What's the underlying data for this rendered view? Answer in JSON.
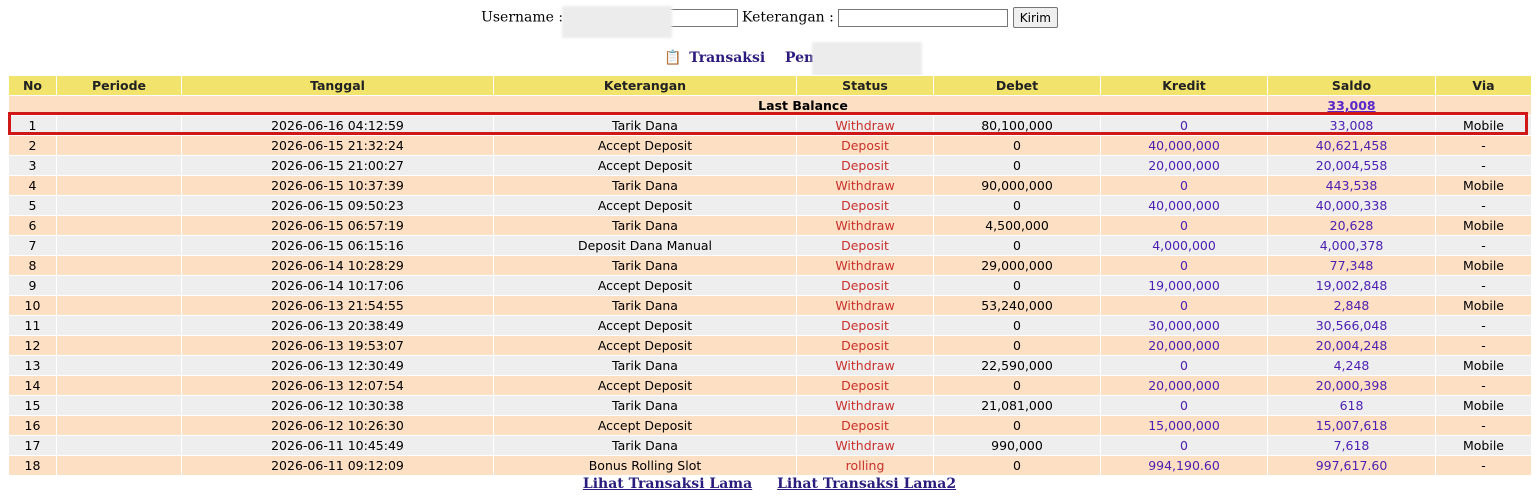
{
  "form": {
    "username_label": "Username :",
    "username_value": "",
    "keterangan_label": "Keterangan :",
    "keterangan_value": "",
    "submit_label": "Kirim"
  },
  "title": {
    "icon": "document-icon",
    "transaksi": "Transaksi",
    "pemain": "Pemain : ro"
  },
  "columns": [
    "No",
    "Periode",
    "Tanggal",
    "Keterangan",
    "Status",
    "Debet",
    "Kredit",
    "Saldo",
    "Via"
  ],
  "last_balance": {
    "label": "Last Balance",
    "value": "33,008"
  },
  "rows": [
    {
      "no": "1",
      "periode": "",
      "tanggal": "2026-06-16 04:12:59",
      "keterangan": "Tarik Dana",
      "status": "Withdraw",
      "debet": "80,100,000",
      "kredit": "0",
      "saldo": "33,008",
      "via": "Mobile"
    },
    {
      "no": "2",
      "periode": "",
      "tanggal": "2026-06-15 21:32:24",
      "keterangan": "Accept Deposit",
      "status": "Deposit",
      "debet": "0",
      "kredit": "40,000,000",
      "saldo": "40,621,458",
      "via": "-"
    },
    {
      "no": "3",
      "periode": "",
      "tanggal": "2026-06-15 21:00:27",
      "keterangan": "Accept Deposit",
      "status": "Deposit",
      "debet": "0",
      "kredit": "20,000,000",
      "saldo": "20,004,558",
      "via": "-"
    },
    {
      "no": "4",
      "periode": "",
      "tanggal": "2026-06-15 10:37:39",
      "keterangan": "Tarik Dana",
      "status": "Withdraw",
      "debet": "90,000,000",
      "kredit": "0",
      "saldo": "443,538",
      "via": "Mobile"
    },
    {
      "no": "5",
      "periode": "",
      "tanggal": "2026-06-15 09:50:23",
      "keterangan": "Accept Deposit",
      "status": "Deposit",
      "debet": "0",
      "kredit": "40,000,000",
      "saldo": "40,000,338",
      "via": "-"
    },
    {
      "no": "6",
      "periode": "",
      "tanggal": "2026-06-15 06:57:19",
      "keterangan": "Tarik Dana",
      "status": "Withdraw",
      "debet": "4,500,000",
      "kredit": "0",
      "saldo": "20,628",
      "via": "Mobile"
    },
    {
      "no": "7",
      "periode": "",
      "tanggal": "2026-06-15 06:15:16",
      "keterangan": "Deposit Dana Manual",
      "status": "Deposit",
      "debet": "0",
      "kredit": "4,000,000",
      "saldo": "4,000,378",
      "via": "-"
    },
    {
      "no": "8",
      "periode": "",
      "tanggal": "2026-06-14 10:28:29",
      "keterangan": "Tarik Dana",
      "status": "Withdraw",
      "debet": "29,000,000",
      "kredit": "0",
      "saldo": "77,348",
      "via": "Mobile"
    },
    {
      "no": "9",
      "periode": "",
      "tanggal": "2026-06-14 10:17:06",
      "keterangan": "Accept Deposit",
      "status": "Deposit",
      "debet": "0",
      "kredit": "19,000,000",
      "saldo": "19,002,848",
      "via": "-"
    },
    {
      "no": "10",
      "periode": "",
      "tanggal": "2026-06-13 21:54:55",
      "keterangan": "Tarik Dana",
      "status": "Withdraw",
      "debet": "53,240,000",
      "kredit": "0",
      "saldo": "2,848",
      "via": "Mobile"
    },
    {
      "no": "11",
      "periode": "",
      "tanggal": "2026-06-13 20:38:49",
      "keterangan": "Accept Deposit",
      "status": "Deposit",
      "debet": "0",
      "kredit": "30,000,000",
      "saldo": "30,566,048",
      "via": "-"
    },
    {
      "no": "12",
      "periode": "",
      "tanggal": "2026-06-13 19:53:07",
      "keterangan": "Accept Deposit",
      "status": "Deposit",
      "debet": "0",
      "kredit": "20,000,000",
      "saldo": "20,004,248",
      "via": "-"
    },
    {
      "no": "13",
      "periode": "",
      "tanggal": "2026-06-13 12:30:49",
      "keterangan": "Tarik Dana",
      "status": "Withdraw",
      "debet": "22,590,000",
      "kredit": "0",
      "saldo": "4,248",
      "via": "Mobile"
    },
    {
      "no": "14",
      "periode": "",
      "tanggal": "2026-06-13 12:07:54",
      "keterangan": "Accept Deposit",
      "status": "Deposit",
      "debet": "0",
      "kredit": "20,000,000",
      "saldo": "20,000,398",
      "via": "-"
    },
    {
      "no": "15",
      "periode": "",
      "tanggal": "2026-06-12 10:30:38",
      "keterangan": "Tarik Dana",
      "status": "Withdraw",
      "debet": "21,081,000",
      "kredit": "0",
      "saldo": "618",
      "via": "Mobile"
    },
    {
      "no": "16",
      "periode": "",
      "tanggal": "2026-06-12 10:26:30",
      "keterangan": "Accept Deposit",
      "status": "Deposit",
      "debet": "0",
      "kredit": "15,000,000",
      "saldo": "15,007,618",
      "via": "-"
    },
    {
      "no": "17",
      "periode": "",
      "tanggal": "2026-06-11 10:45:49",
      "keterangan": "Tarik Dana",
      "status": "Withdraw",
      "debet": "990,000",
      "kredit": "0",
      "saldo": "7,618",
      "via": "Mobile"
    },
    {
      "no": "18",
      "periode": "",
      "tanggal": "2026-06-11 09:12:09",
      "keterangan": "Bonus Rolling Slot",
      "status": "rolling",
      "debet": "0",
      "kredit": "994,190.60",
      "saldo": "997,617.60",
      "via": "-"
    }
  ],
  "links": {
    "lama": "Lihat Transaksi Lama",
    "lama2": "Lihat Transaksi Lama2"
  },
  "colors": {
    "header": "#f1e36c",
    "row_odd": "#eeeeee",
    "row_even": "#fde0c3",
    "status": "#c9302c",
    "value_blue": "#4a1fb0",
    "highlight": "#d01818"
  }
}
